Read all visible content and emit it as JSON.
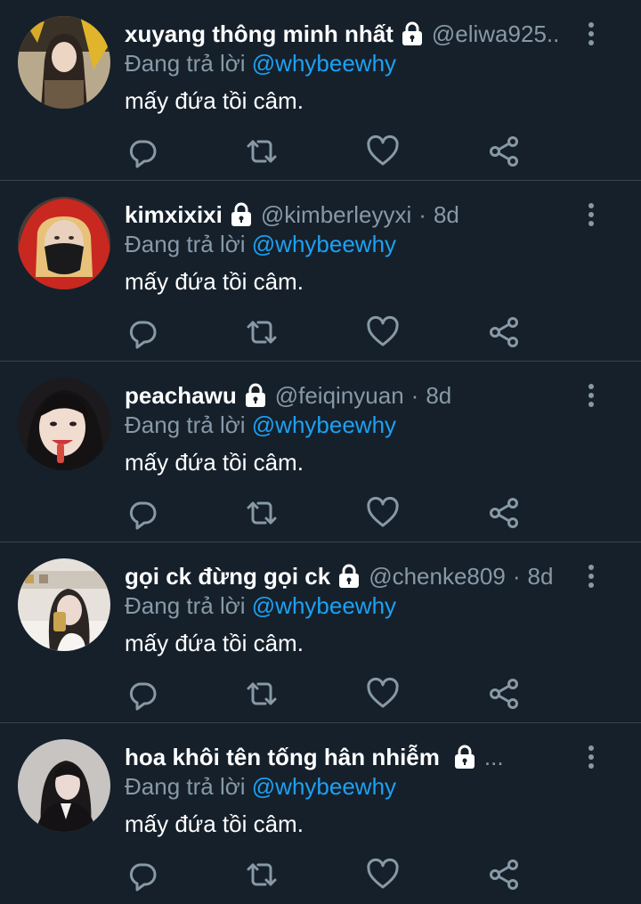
{
  "colors": {
    "background": "#15202b",
    "divider": "#38444d",
    "secondary_text": "#8899a6",
    "mention": "#1da1f2",
    "primary_text": "#ffffff"
  },
  "icons": {
    "protected": "lock-icon",
    "more": "more-vertical-icon",
    "reply": "reply-icon",
    "retweet": "retweet-icon",
    "like": "heart-icon",
    "share": "share-icon"
  },
  "tweets": [
    {
      "name": "xuyang thông minh nhất",
      "handle": "@eliwa925..",
      "time": "",
      "reply_prefix": "Đang trả lời ",
      "reply_to": "@whybeewhy",
      "text": "mấy đứa tồi câm."
    },
    {
      "name": "kimxixixi",
      "handle": "@kimberleyyxi",
      "time": "8d",
      "reply_prefix": "Đang trả lời ",
      "reply_to": "@whybeewhy",
      "text": "mấy đứa tồi câm."
    },
    {
      "name": "peachawu",
      "handle": "@feiqinyuan",
      "time": "8d",
      "reply_prefix": "Đang trả lời ",
      "reply_to": "@whybeewhy",
      "text": "mấy đứa tồi câm."
    },
    {
      "name": "gọi ck đừng gọi ck",
      "handle": "@chenke809",
      "time": "8d",
      "reply_prefix": "Đang trả lời ",
      "reply_to": "@whybeewhy",
      "text": "mấy đứa tồi câm."
    },
    {
      "name": "hoa khôi tên tống hân nhiễm",
      "handle": "...",
      "time": "",
      "reply_prefix": "Đang trả lời ",
      "reply_to": "@whybeewhy",
      "text": "mấy đứa tồi câm."
    }
  ]
}
